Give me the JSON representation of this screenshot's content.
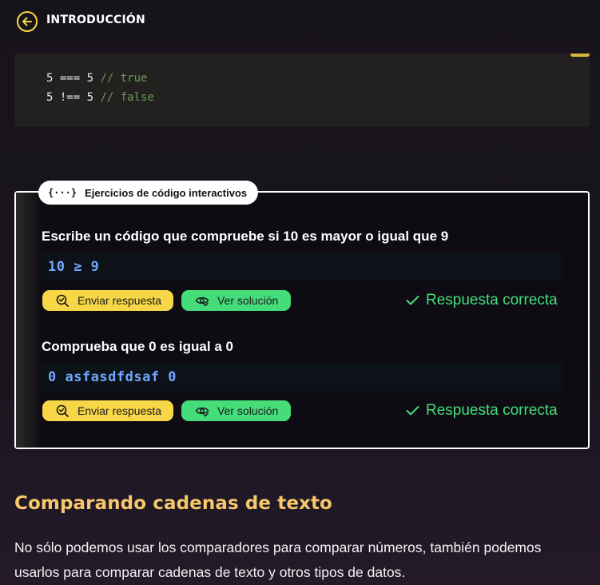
{
  "header": {
    "title": "INTRODUCCIÓN",
    "back_icon": "arrow-left-icon"
  },
  "code_block": {
    "lines": [
      {
        "code": "5 === 5 ",
        "comment": "// true"
      },
      {
        "code": "5 !== 5 ",
        "comment": "// false"
      }
    ]
  },
  "exercises": {
    "badge_icon_text": "{···}",
    "badge_label": "Ejercicios de código interactivos",
    "items": [
      {
        "question": "Escribe un código que compruebe si 10 es mayor o igual que 9",
        "answer": "10 ≥ 9",
        "submit_label": "Enviar respuesta",
        "solution_label": "Ver solución",
        "status": "Respuesta correcta"
      },
      {
        "question": "Comprueba que 0 es igual a 0",
        "answer": "0 asfasdfdsaf 0",
        "submit_label": "Enviar respuesta",
        "solution_label": "Ver solución",
        "status": "Respuesta correcta"
      }
    ]
  },
  "section": {
    "heading": "Comparando cadenas de texto",
    "paragraph": "No sólo podemos usar los comparadores para comparar números, también podemos usarlos para comparar cadenas de texto y otros tipos de datos."
  },
  "colors": {
    "accent_yellow": "#f7d747",
    "accent_green": "#45dc7a",
    "heading_gold": "#f6c86a",
    "code_blue": "#6fa8ff"
  }
}
